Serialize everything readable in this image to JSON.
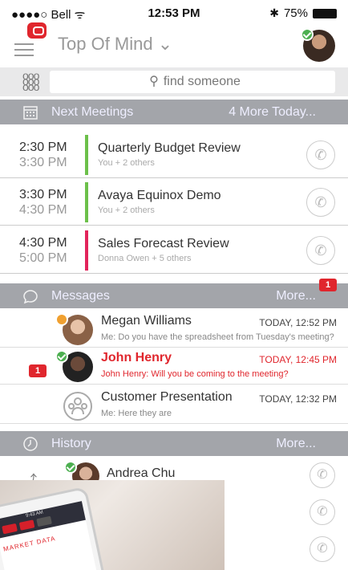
{
  "status_bar": {
    "carrier": "●●●●○ Bell ᯤ",
    "time": "12:53 PM",
    "battery": "75%"
  },
  "header": {
    "title": "Top Of Mind ⌄"
  },
  "search": {
    "placeholder": "find someone"
  },
  "next_meetings": {
    "label": "Next Meetings",
    "more": "4 More Today...",
    "items": [
      {
        "start": "2:30 PM",
        "end": "3:30 PM",
        "title": "Quarterly Budget Review",
        "sub": "You + 2 others",
        "color": "#6cc04a"
      },
      {
        "start": "3:30 PM",
        "end": "4:30 PM",
        "title": "Avaya Equinox Demo",
        "sub": "You + 2 others",
        "color": "#6cc04a"
      },
      {
        "start": "4:30 PM",
        "end": "5:00 PM",
        "title": "Sales Forecast Review",
        "sub": "Donna Owen + 5 others",
        "color": "#e2245b"
      }
    ]
  },
  "messages": {
    "label": "Messages",
    "more": "More...",
    "unread_badge": "1",
    "items": [
      {
        "name": "Megan Williams",
        "preview": "Me: Do you have the spreadsheet from Tuesday's meeting?",
        "time": "TODAY, 12:52 PM"
      },
      {
        "name": "John Henry",
        "preview": "John Henry: Will you be coming to the meeting?",
        "time": "TODAY, 12:45 PM",
        "badge": "1"
      },
      {
        "name": "Customer Presentation",
        "preview": "Me: Here they are",
        "time": "TODAY, 12:32 PM"
      }
    ]
  },
  "history": {
    "label": "History",
    "more": "More...",
    "items": [
      {
        "name": "Andrea Chu"
      }
    ]
  },
  "promo": {
    "time": "9:43 AM",
    "market_label": "MARKET DATA"
  },
  "colors": {
    "accent": "#e0262d",
    "section_bg": "#a3a5aa",
    "online": "#4caf50",
    "away": "#f0a030"
  }
}
